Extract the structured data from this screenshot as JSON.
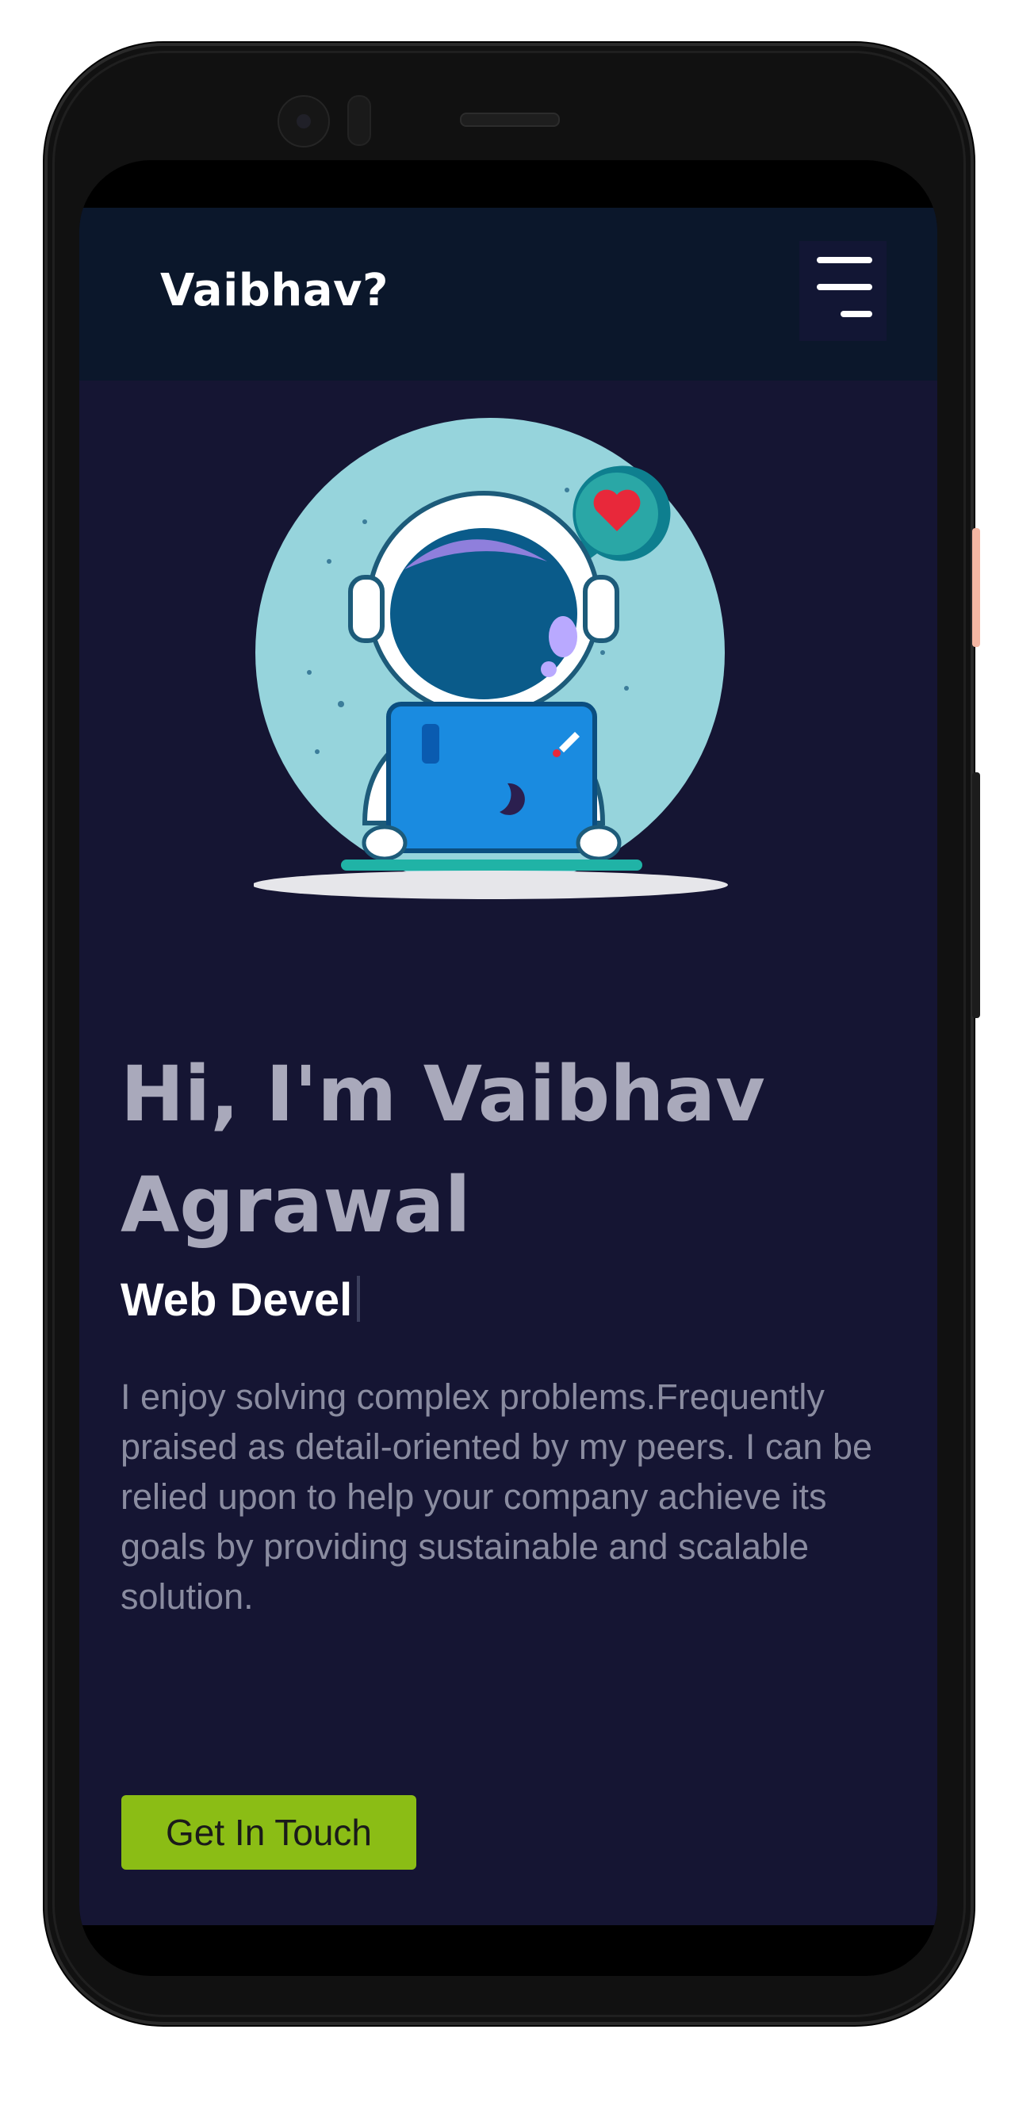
{
  "header": {
    "brand": "Vaibhav?",
    "menu_icon": "hamburger-menu-icon"
  },
  "hero": {
    "illustration": "astronaut-laptop-illustration",
    "title": "Hi, I'm Vaibhav Agrawal",
    "role_typed": "Web Devel",
    "bio": "I enjoy solving complex problems.Frequently praised as detail-oriented by my peers. I can be relied upon to help your company achieve its goals by providing sustainable and scalable solution.",
    "cta_label": "Get In Touch"
  },
  "colors": {
    "background": "#151533",
    "header": "#0b172b",
    "cta": "#8bbd15",
    "title": "#a9a9bb",
    "body_text": "#8a8ca0"
  }
}
